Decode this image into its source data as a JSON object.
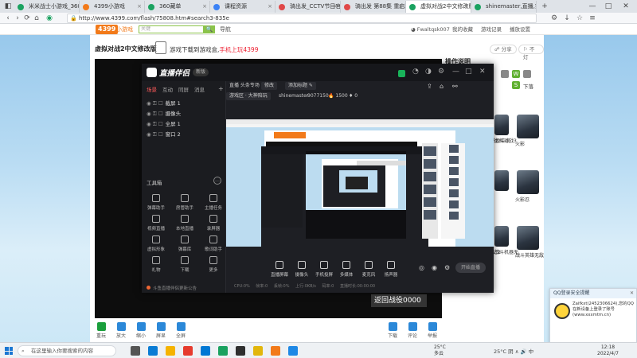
{
  "browser": {
    "tabs": [
      {
        "label": "米米战士小游戏_360搜索",
        "color": "#1aa260"
      },
      {
        "label": "4399小游戏",
        "color": "#f27a1a"
      },
      {
        "label": "360藏单",
        "color": "#1aa260"
      },
      {
        "label": "课程资源",
        "color": "#3b82f6"
      },
      {
        "label": "骑出发_CCTV节目官网-欢乐",
        "color": "#e04848"
      },
      {
        "label": "骑出发 第88集 重启精打上",
        "color": "#e04848"
      },
      {
        "label": "虚拟对战2中文修改版,虚拟",
        "color": "#1aa260",
        "active": true
      },
      {
        "label": "shinemaster,直播,实操视频",
        "color": "#1aa260"
      }
    ],
    "url": "http://www.4399.com/flash/75808.htm#search3-835e"
  },
  "site": {
    "logo": "4399",
    "logo_sub": "小游戏",
    "search_placeholder": "关键",
    "nav_link": "导航",
    "user": "Fwaltqsk007",
    "favorites": "我的收藏",
    "history": "游戏记录",
    "settings": "播放设置"
  },
  "page": {
    "game_title": "虚拟对战2中文修改版",
    "mobile_promo_prefix": "游戏下载到游戏盒,",
    "mobile_promo_link": "手机上玩4399",
    "share_label": "分享",
    "dislike_label": "不灯",
    "ops_title": "操作说明",
    "key_w": "W",
    "key_s": "S",
    "key_down_label": "下落",
    "thumbs": [
      {
        "label": "虚拟对战2中文"
      },
      {
        "label": "虚拟对战3"
      },
      {
        "label": "火影"
      },
      {
        "label": ""
      },
      {
        "label": ""
      },
      {
        "label": "火影忍"
      },
      {
        "label": "虚拟战记2"
      },
      {
        "label": "战斗机器无"
      },
      {
        "label": "战斗英雄无敌"
      }
    ],
    "return_text": "返回战役0000",
    "ad_text": "无限传长",
    "toolbar": [
      {
        "label": "重玩",
        "color": "#1a9f3c"
      },
      {
        "label": "放大",
        "color": "#2b88d8"
      },
      {
        "label": "缩小",
        "color": "#2b88d8"
      },
      {
        "label": "屏显",
        "color": "#2b88d8"
      },
      {
        "label": "全屏",
        "color": "#2b88d8"
      }
    ],
    "toolbar_right": [
      {
        "label": "下载",
        "color": "#2b88d8"
      },
      {
        "label": "评论",
        "color": "#2b88d8"
      },
      {
        "label": "举报",
        "color": "#2b88d8"
      }
    ]
  },
  "stream": {
    "app_name": "直播伴侣",
    "badge": "新版",
    "left_tabs": [
      "场景",
      "互动",
      "同屏",
      "消息"
    ],
    "scenes": [
      "截屏 1",
      "摄像头",
      "全屏 1",
      "窗口 2"
    ],
    "tools_title": "工具箱",
    "tools": [
      "弹幕助手",
      "房管助手",
      "主播任务",
      "视频直播",
      "本地直播",
      "录屏器",
      "虚拟形象",
      "弹幕库",
      "歌词助手",
      "礼物",
      "下载",
      "更多"
    ],
    "notice": "斗鱼直播伴侣更新公告",
    "room_title": "直播 头条专场",
    "room_status": "修改",
    "room_name": "添加标题",
    "room_category": "游戏区 · 大神陪玩",
    "streamer": "shinemaster",
    "room_id": "9077150",
    "viewers": "1500",
    "gifts": "0",
    "bottom_buttons": [
      "直播屏幕",
      "摄像头",
      "手机投屏",
      "多媒体",
      "麦克风",
      "扬声器"
    ],
    "live_button": "开始直播",
    "stats": "CPU:0% 帧率:0 丢帧:0% 上行:0KB/s 码率:0 直播时长:00:00:00"
  },
  "qq": {
    "header": "QQ登录安全提醒",
    "body": "Zaifkxt(2452306624),您的QQ在新设备上登录了账号 (www.xxxmtm.cn)"
  },
  "taskbar": {
    "search_placeholder": "在这里输入你要搜索的内容",
    "weather_temp": "25°C",
    "weather_desc": "多云",
    "tray": "25°C 阴 ∧ 🔊 中",
    "time": "12:18",
    "date": "2022/4/7"
  }
}
